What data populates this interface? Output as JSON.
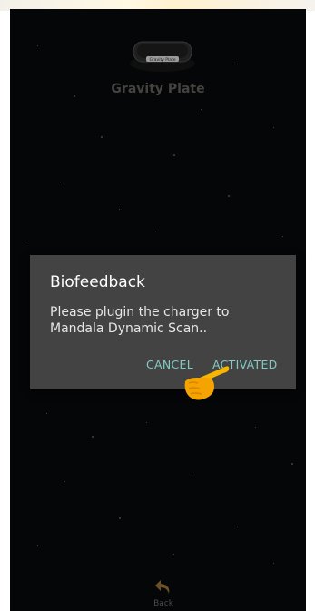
{
  "device": {
    "title": "Gravity Plate",
    "icon": "gravity-plate-device-icon",
    "badge_text": "Gravity Plate"
  },
  "dialog": {
    "title": "Biofeedback",
    "message": "Please plugin the charger to Mandala Dynamic Scan..",
    "cancel_label": "CANCEL",
    "activated_label": "ACTIVATED"
  },
  "navigation": {
    "back_label": "Back",
    "back_icon": "undo-arrow-icon"
  },
  "colors": {
    "background": "#07080b",
    "dialog_bg": "#434343",
    "button_text": "#80cbc4",
    "back_icon": "#6b5226"
  }
}
